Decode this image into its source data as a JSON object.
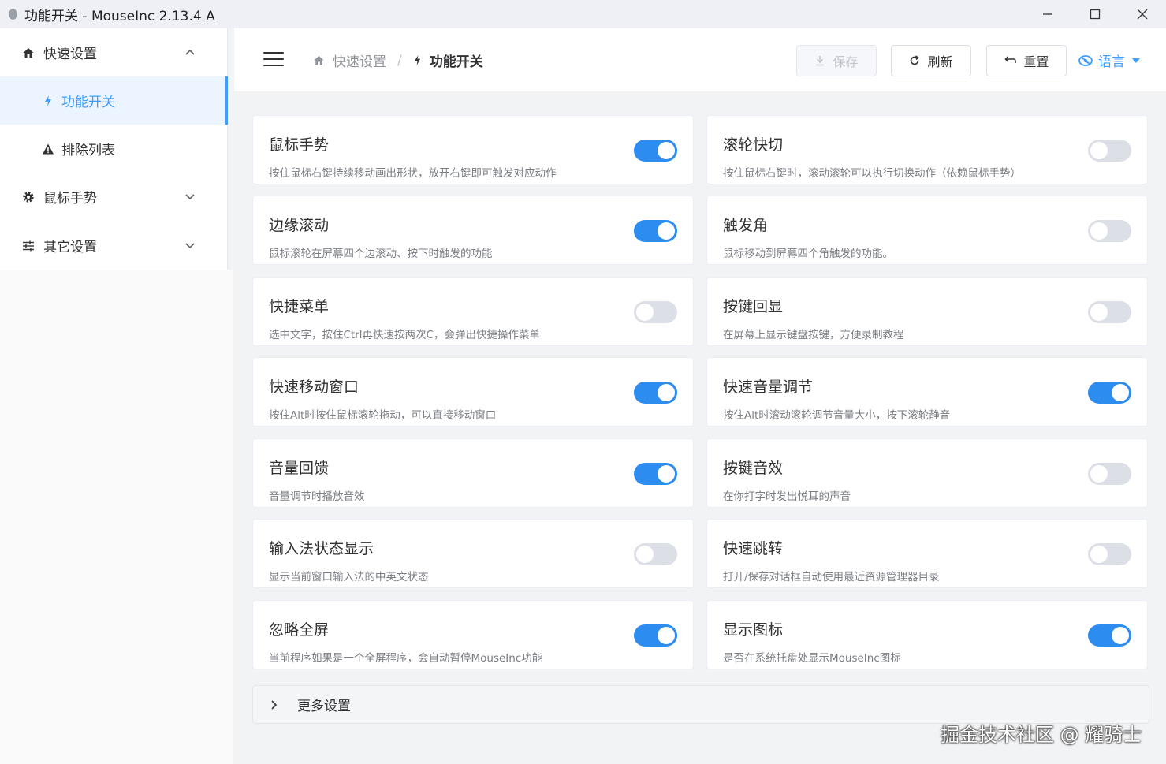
{
  "window": {
    "title": "功能开关 - MouseInc 2.13.4 A"
  },
  "sidebar": {
    "items": [
      {
        "label": "快速设置",
        "icon": "home-icon",
        "level": 1,
        "expanded": true
      },
      {
        "label": "功能开关",
        "icon": "bolt-icon",
        "level": 2,
        "active": true
      },
      {
        "label": "排除列表",
        "icon": "warning-icon",
        "level": 2
      },
      {
        "label": "鼠标手势",
        "icon": "gear-icon",
        "level": 1,
        "expanded": false
      },
      {
        "label": "其它设置",
        "icon": "sliders-icon",
        "level": 1,
        "expanded": false
      }
    ]
  },
  "header": {
    "breadcrumb": [
      {
        "label": "快速设置",
        "icon": "home-icon"
      },
      {
        "label": "功能开关",
        "icon": "bolt-icon"
      }
    ],
    "separator": "/",
    "save_label": "保存",
    "refresh_label": "刷新",
    "reset_label": "重置",
    "language_label": "语言"
  },
  "features": [
    {
      "title": "鼠标手势",
      "desc": "按住鼠标右键持续移动画出形状，放开右键即可触发对应动作",
      "enabled": true
    },
    {
      "title": "滚轮快切",
      "desc": "按住鼠标右键时，滚动滚轮可以执行切换动作（依赖鼠标手势）",
      "enabled": false
    },
    {
      "title": "边缘滚动",
      "desc": "鼠标滚轮在屏幕四个边滚动、按下时触发的功能",
      "enabled": true
    },
    {
      "title": "触发角",
      "desc": "鼠标移动到屏幕四个角触发的功能。",
      "enabled": false
    },
    {
      "title": "快捷菜单",
      "desc": "选中文字，按住Ctrl再快速按两次C，会弹出快捷操作菜单",
      "enabled": false
    },
    {
      "title": "按键回显",
      "desc": "在屏幕上显示键盘按键，方便录制教程",
      "enabled": false
    },
    {
      "title": "快速移动窗口",
      "desc": "按住Alt时按住鼠标滚轮拖动，可以直接移动窗口",
      "enabled": true
    },
    {
      "title": "快速音量调节",
      "desc": "按住Alt时滚动滚轮调节音量大小，按下滚轮静音",
      "enabled": true
    },
    {
      "title": "音量回馈",
      "desc": "音量调节时播放音效",
      "enabled": true
    },
    {
      "title": "按键音效",
      "desc": "在你打字时发出悦耳的声音",
      "enabled": false
    },
    {
      "title": "输入法状态显示",
      "desc": "显示当前窗口输入法的中英文状态",
      "enabled": false
    },
    {
      "title": "快速跳转",
      "desc": "打开/保存对话框自动使用最近资源管理器目录",
      "enabled": false
    },
    {
      "title": "忽略全屏",
      "desc": "当前程序如果是一个全屏程序，会自动暂停MouseInc功能",
      "enabled": true
    },
    {
      "title": "显示图标",
      "desc": "是否在系统托盘处显示MouseInc图标",
      "enabled": true
    }
  ],
  "more_settings_label": "更多设置",
  "watermark": "掘金技术社区 @ 耀骑士",
  "colors": {
    "accent": "#409eff",
    "switch_on": "#2d8cf0",
    "switch_off": "#dcdfe6"
  }
}
